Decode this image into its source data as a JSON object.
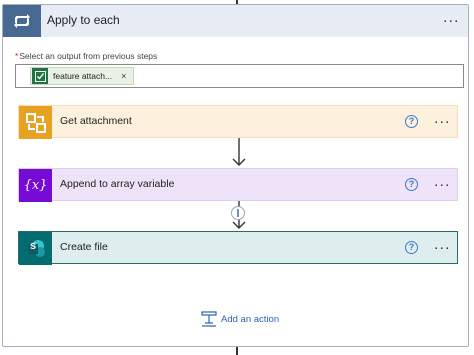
{
  "loop": {
    "title": "Apply to each",
    "icon": "loop-icon",
    "output_label": "Select an output from previous steps",
    "required_mark": "*",
    "token": {
      "label": "feature attach...",
      "close": "×",
      "icon": "excel-sheet-icon"
    }
  },
  "actions": [
    {
      "title": "Get attachment",
      "icon": "attachment-connector-icon",
      "color": "#e8a222",
      "help": "?"
    },
    {
      "title": "Append to array variable",
      "icon": "variable-icon",
      "icon_glyph": "{x}",
      "color": "#770bd6",
      "help": "?"
    },
    {
      "title": "Create file",
      "icon": "sharepoint-icon",
      "icon_glyph": "s",
      "color": "#036c70",
      "help": "?"
    }
  ],
  "add_action": {
    "label": "Add an action",
    "icon": "add-action-icon"
  },
  "more_options": "···",
  "colors": {
    "accent": "#2a62b4",
    "loop_header": "#486991"
  }
}
